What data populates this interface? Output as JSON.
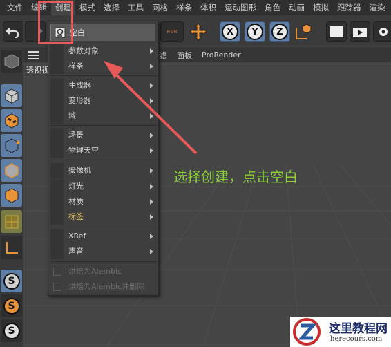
{
  "menubar": {
    "items": [
      "文件",
      "编辑",
      "创建",
      "模式",
      "选择",
      "工具",
      "网格",
      "样条",
      "体积",
      "运动图形",
      "角色",
      "动画",
      "模拟",
      "跟踪器",
      "渲染"
    ]
  },
  "toolbar": {
    "axes": [
      "X",
      "Y",
      "Z"
    ],
    "psr_label": "PSR"
  },
  "bar2": {
    "partial_label": "透视视",
    "filter_label": "滤",
    "panel_label": "面板",
    "prorender_label": "ProRender"
  },
  "viewport": {
    "label": "透视视图"
  },
  "dropdown": {
    "top_item": "空白",
    "items": [
      {
        "label": "参数对象",
        "submenu": true,
        "style": "normal"
      },
      {
        "label": "样条",
        "submenu": true,
        "style": "normal"
      },
      {
        "label": "生成器",
        "submenu": true,
        "style": "normal"
      },
      {
        "label": "变形器",
        "submenu": true,
        "style": "normal"
      },
      {
        "label": "域",
        "submenu": true,
        "style": "normal"
      },
      {
        "label": "场景",
        "submenu": true,
        "style": "normal"
      },
      {
        "label": "物理天空",
        "submenu": true,
        "style": "normal"
      },
      {
        "label": "摄像机",
        "submenu": true,
        "style": "normal"
      },
      {
        "label": "灯光",
        "submenu": true,
        "style": "normal"
      },
      {
        "label": "材质",
        "submenu": true,
        "style": "normal"
      },
      {
        "label": "标签",
        "submenu": true,
        "style": "yellow"
      },
      {
        "label": "XRef",
        "submenu": true,
        "style": "normal"
      },
      {
        "label": "声音",
        "submenu": true,
        "style": "normal"
      },
      {
        "label": "烘焙为Alembic",
        "submenu": false,
        "style": "dim"
      },
      {
        "label": "烘焙为Alembic并删除",
        "submenu": false,
        "style": "dim"
      }
    ]
  },
  "annotation": {
    "text": "选择创建，点击空白",
    "color": "#8bcf3a",
    "arrow_color": "#e85a5a"
  },
  "watermark": {
    "title": "这里教程网",
    "url": "herecours.com"
  },
  "colors": {
    "accent_blue": "#5f7ea6",
    "orange": "#e8923a",
    "red": "#e85a5a"
  }
}
